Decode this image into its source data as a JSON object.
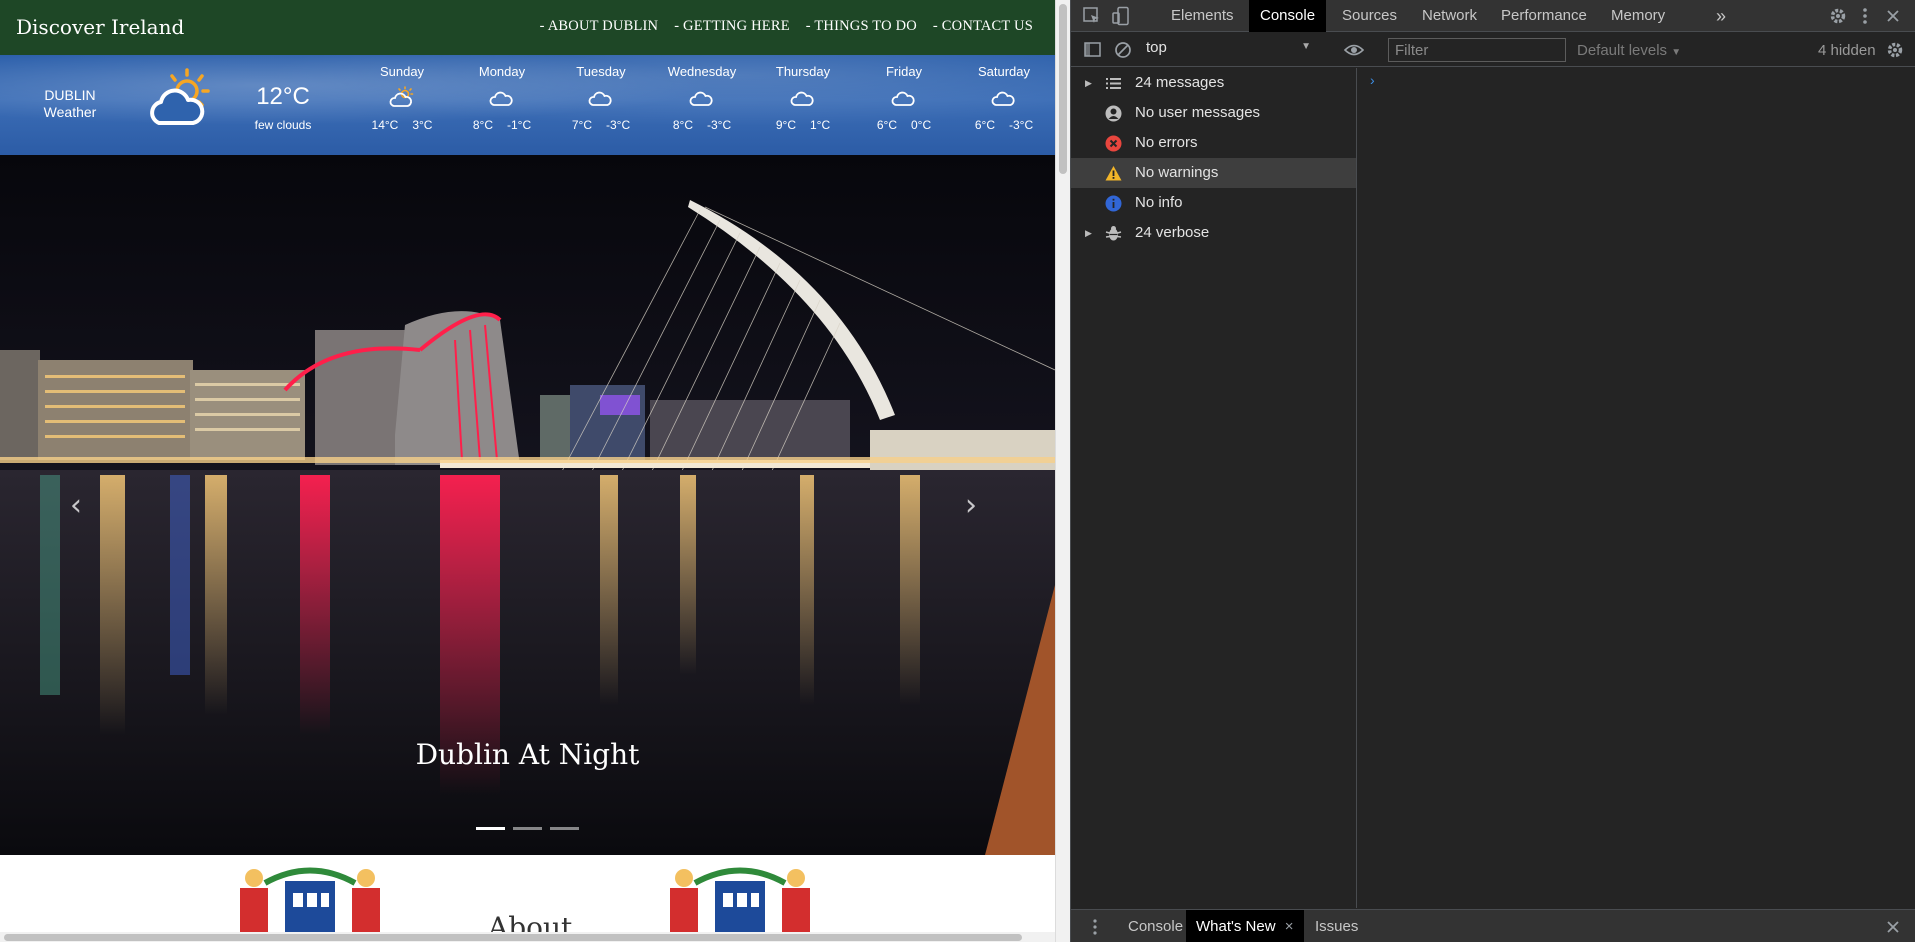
{
  "site": {
    "brand": "Discover Ireland",
    "nav": [
      "- ABOUT DUBLIN",
      "- GETTING HERE",
      "- THINGS TO DO",
      "- CONTACT US"
    ],
    "weather": {
      "city_line1": "DUBLIN",
      "city_line2": "Weather",
      "current_temp": "12°C",
      "description": "few clouds",
      "current_icon": "sun-cloud-icon",
      "days": [
        {
          "name": "Sunday",
          "high": "14°C",
          "low": "3°C",
          "icon": "sun-cloud-icon"
        },
        {
          "name": "Monday",
          "high": "8°C",
          "low": "-1°C",
          "icon": "cloud-icon"
        },
        {
          "name": "Tuesday",
          "high": "7°C",
          "low": "-3°C",
          "icon": "cloud-icon"
        },
        {
          "name": "Wednesday",
          "high": "8°C",
          "low": "-3°C",
          "icon": "cloud-icon"
        },
        {
          "name": "Thursday",
          "high": "9°C",
          "low": "1°C",
          "icon": "cloud-icon"
        },
        {
          "name": "Friday",
          "high": "6°C",
          "low": "0°C",
          "icon": "cloud-icon"
        },
        {
          "name": "Saturday",
          "high": "6°C",
          "low": "-3°C",
          "icon": "cloud-icon"
        }
      ]
    },
    "hero": {
      "caption": "Dublin At Night",
      "prev_icon": "chevron-left-icon",
      "next_icon": "chevron-right-icon",
      "slides": 3,
      "active_slide": 1
    },
    "about_heading": "About"
  },
  "devtools": {
    "tabs": [
      "Elements",
      "Console",
      "Sources",
      "Network",
      "Performance",
      "Memory"
    ],
    "active_tab": "Console",
    "more_tabs_icon": "double-chevron-icon",
    "context": "top",
    "filter_placeholder": "Filter",
    "levels": "Default levels",
    "hidden": "4 hidden",
    "sidebar": [
      {
        "label": "24 messages",
        "icon": "list-icon",
        "expandable": true
      },
      {
        "label": "No user messages",
        "icon": "user-icon",
        "expandable": false
      },
      {
        "label": "No errors",
        "icon": "error-icon",
        "expandable": false
      },
      {
        "label": "No warnings",
        "icon": "warning-icon",
        "expandable": false,
        "selected": true
      },
      {
        "label": "No info",
        "icon": "info-icon",
        "expandable": false
      },
      {
        "label": "24 verbose",
        "icon": "bug-icon",
        "expandable": true
      }
    ],
    "prompt": "›",
    "drawer_tabs": [
      "Console",
      "What's New",
      "Issues"
    ],
    "drawer_active": "What's New",
    "close_symbol": "×"
  },
  "colors": {
    "nav_bg": "#1e4726",
    "weather_bg": "#2f63ad",
    "devtools_bg": "#242424",
    "error": "#e8463e",
    "warning": "#f2b529",
    "info": "#3166d6",
    "prompt": "#3d8fe6"
  }
}
